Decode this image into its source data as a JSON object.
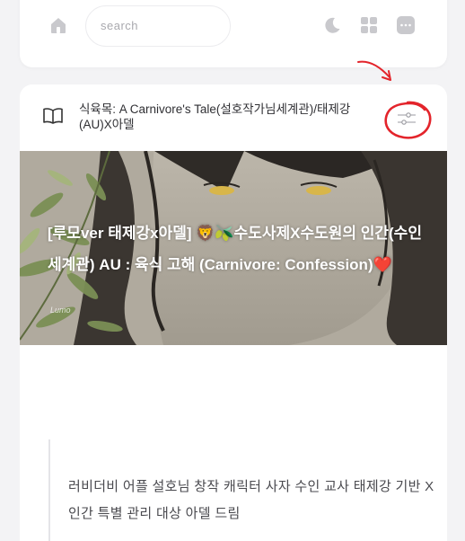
{
  "header": {
    "search": {
      "placeholder": "search",
      "value": ""
    },
    "icons": [
      "home-icon",
      "moon-icon",
      "grid-icon",
      "more-icon"
    ]
  },
  "post": {
    "title": "식육목: A Carnivore's Tale(설호작가님세계관)/태제강(AU)X아델",
    "hero_title": "[루모ver 태제강x아델] 🦁🫒수도사제X수도원의 인간(수인세계관) AU : 육식 고해 (Carnivore: Confession)❤️",
    "hero_watermark": "Lumo",
    "description": "러비더비 어플 설호님 창작 캐릭터 사자 수인 교사 태제강 기반 X인간 특별 관리 대상 아델 드림",
    "icons": [
      "book-icon",
      "toggle-settings-icon"
    ]
  },
  "annotation": {
    "color": "#e3242b"
  },
  "colors": {
    "background": "#f3f3f5",
    "card": "#ffffff",
    "text": "#2f2f33",
    "icon": "#c4c4c8"
  }
}
